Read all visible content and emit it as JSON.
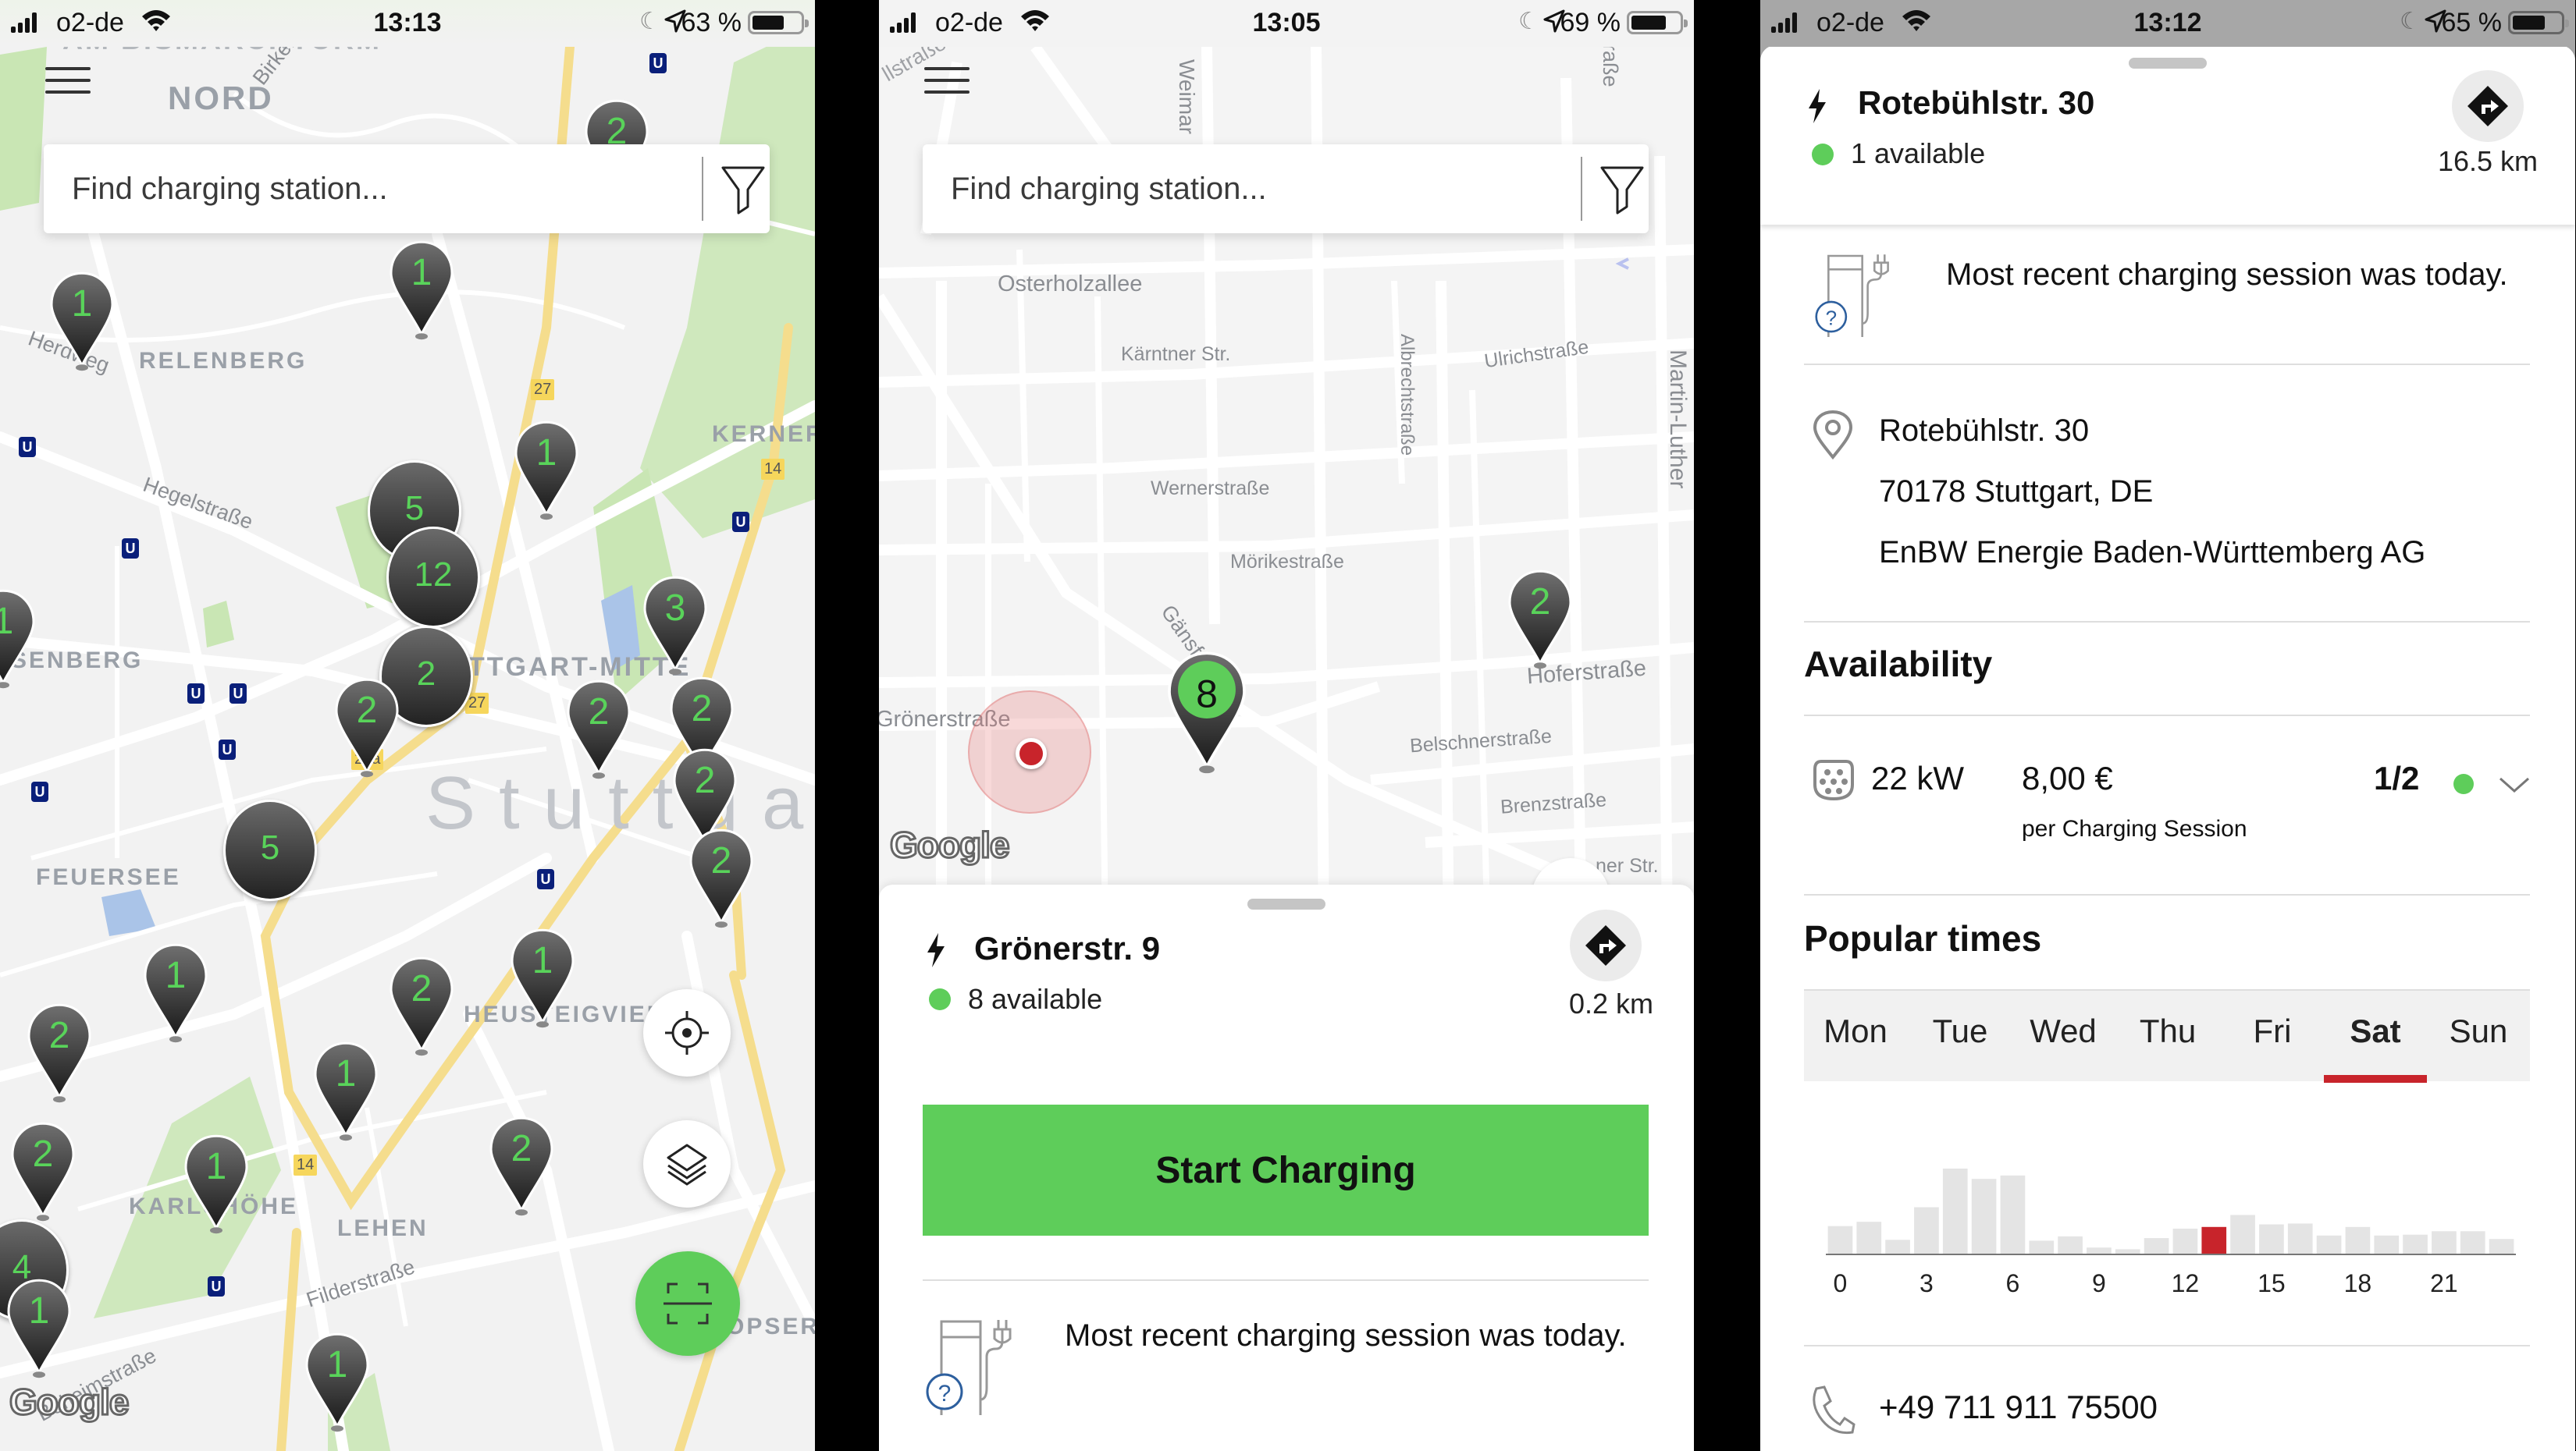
{
  "status_bars": [
    {
      "carrier": "o2-de",
      "time": "13:13",
      "battery": "63 %",
      "battery_level": 0.63
    },
    {
      "carrier": "o2-de",
      "time": "13:05",
      "battery": "69 %",
      "battery_level": 0.69
    },
    {
      "carrier": "o2-de",
      "time": "13:12",
      "battery": "65 %",
      "battery_level": 0.65
    }
  ],
  "search": {
    "placeholder": "Find charging station..."
  },
  "map1": {
    "districts": [
      "AM BISMARCKTURM",
      "NORD",
      "RELENBERG",
      "KERNER",
      "SENBERG",
      "TTGART-MITTE",
      "FEUERSEE",
      "HEUSTEIGVIER",
      "KARLSHÖHE",
      "LEHEN",
      "OPSER"
    ],
    "streets": [
      "Birkenwaldstraße",
      "Herdweg",
      "Hegelstraße",
      "Filderstraße",
      "Böheimstraße"
    ],
    "city": "Stuttgart",
    "road_badges": [
      "27",
      "14",
      "27",
      "27a",
      "14"
    ],
    "markers": [
      {
        "count": "1",
        "type": "pin"
      },
      {
        "count": "1",
        "type": "pin"
      },
      {
        "count": "2",
        "type": "pin"
      },
      {
        "count": "1",
        "type": "pin"
      },
      {
        "count": "5",
        "type": "cluster"
      },
      {
        "count": "12",
        "type": "cluster"
      },
      {
        "count": "3",
        "type": "pin"
      },
      {
        "count": "2",
        "type": "cluster"
      },
      {
        "count": "2",
        "type": "pin"
      },
      {
        "count": "2",
        "type": "pin"
      },
      {
        "count": "2",
        "type": "pin"
      },
      {
        "count": "2",
        "type": "pin"
      },
      {
        "count": "2",
        "type": "pin"
      },
      {
        "count": "5",
        "type": "cluster"
      },
      {
        "count": "1",
        "type": "pin"
      },
      {
        "count": "1",
        "type": "pin"
      },
      {
        "count": "2",
        "type": "pin"
      },
      {
        "count": "2",
        "type": "pin"
      },
      {
        "count": "1",
        "type": "pin"
      },
      {
        "count": "2",
        "type": "pin"
      },
      {
        "count": "1",
        "type": "pin"
      },
      {
        "count": "2",
        "type": "pin"
      },
      {
        "count": "4",
        "type": "cluster"
      },
      {
        "count": "1",
        "type": "pin"
      },
      {
        "count": "1",
        "type": "pin"
      },
      {
        "count": "1",
        "type": "pin"
      }
    ],
    "google_logo": "Google"
  },
  "map2": {
    "streets": [
      "Osterholzallee",
      "Kärntner Str.",
      "Ulrichstraße",
      "Albrechtstraße",
      "Martin-Luther",
      "Wernerstraße",
      "Mörikestraße",
      "Gänsfußallee",
      "Hoferstraße",
      "Grönerstraße",
      "Belschnerstraße",
      "Brenzstraße",
      "Weimar",
      "ner Str.",
      "raße",
      "llstraße"
    ],
    "markers": [
      {
        "count": "8",
        "selected": true
      },
      {
        "count": "2",
        "selected": false
      }
    ],
    "google_logo": "Google"
  },
  "station_card": {
    "name": "Grönerstr. 9",
    "availability": "8 available",
    "distance": "0.2 km",
    "start_button": "Start Charging",
    "recent_session": "Most recent charging session was today."
  },
  "station_detail": {
    "name": "Rotebühlstr. 30",
    "availability": "1 available",
    "distance": "16.5 km",
    "recent_session": "Most recent charging session was today.",
    "address": [
      "Rotebühlstr. 30",
      "70178 Stuttgart, DE",
      "EnBW Energie Baden-Württemberg AG"
    ],
    "availability_title": "Availability",
    "connector": {
      "power": "22 kW",
      "price": "8,00 €",
      "price_unit": "per Charging Session",
      "count": "1/2"
    },
    "popular_times_title": "Popular times",
    "days": [
      "Mon",
      "Tue",
      "Wed",
      "Thu",
      "Fri",
      "Sat",
      "Sun"
    ],
    "selected_day": "Sat",
    "phone": "+49 711 911 75500"
  },
  "colors": {
    "accent_green": "#5ecd5a",
    "highlight_red": "#c8242b",
    "marker_dark": "#333333"
  },
  "chart_data": {
    "type": "bar",
    "title": "Popular times",
    "selected_day": "Sat",
    "categories": [
      0,
      1,
      2,
      3,
      4,
      5,
      6,
      7,
      8,
      9,
      10,
      11,
      12,
      13,
      14,
      15,
      16,
      17,
      18,
      19,
      20,
      21,
      22,
      23
    ],
    "tick_labels": [
      "0",
      "3",
      "6",
      "9",
      "12",
      "15",
      "18",
      "21"
    ],
    "values": [
      33,
      38,
      17,
      55,
      100,
      88,
      92,
      16,
      21,
      8,
      6,
      19,
      30,
      32,
      46,
      35,
      36,
      22,
      32,
      22,
      23,
      27,
      27,
      18
    ],
    "highlighted_index": 13,
    "xlabel": "",
    "ylabel": "",
    "ylim": [
      0,
      100
    ],
    "grid": false
  }
}
